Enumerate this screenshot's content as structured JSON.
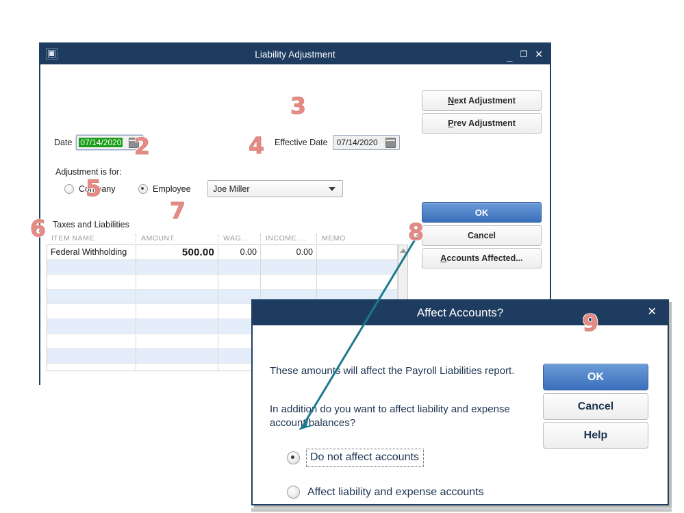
{
  "main_window": {
    "title": "Liability Adjustment",
    "system_menu_icon": "window-system-menu-icon",
    "minimize_glyph": "_",
    "maximize_glyph": "❐",
    "close_glyph": "✕",
    "buttons": {
      "next_adjustment": "Next Adjustment",
      "next_adjustment_accel": "N",
      "prev_adjustment": "Prev Adjustment",
      "prev_adjustment_accel": "P",
      "ok": "OK",
      "cancel": "Cancel",
      "accounts_affected": "Accounts Affected...",
      "accounts_affected_accel": "A"
    },
    "date_field": {
      "label": "Date",
      "value": "07/14/2020",
      "calendar_icon": "calendar-icon"
    },
    "effective_date_field": {
      "label": "Effective Date",
      "value": "07/14/2020",
      "calendar_icon": "calendar-icon"
    },
    "adjustment_for": {
      "label": "Adjustment is for:",
      "options": [
        {
          "label": "Company",
          "selected": false
        },
        {
          "label": "Employee",
          "selected": true
        }
      ]
    },
    "employee_select": {
      "value": "Joe Miller",
      "caret_icon": "chevron-down-icon"
    },
    "taxes_section": {
      "label": "Taxes and Liabilities",
      "columns": [
        "ITEM NAME",
        "AMOUNT",
        "WAG...",
        "INCOME ...",
        "MEMO"
      ],
      "rows": [
        {
          "item_name": "Federal Withholding",
          "amount": "500.00",
          "wage_base": "0.00",
          "income_subject_to_tax": "0.00",
          "memo": ""
        }
      ],
      "empty_row_count": 8,
      "scrollbar_up_icon": "scroll-up-arrow-icon"
    }
  },
  "affect_dialog": {
    "title": "Affect Accounts?",
    "close_glyph": "✕",
    "paragraph_1": "These amounts will affect the Payroll Liabilities report.",
    "paragraph_2": "In addition do you want to affect liability and expense account balances?",
    "options": [
      {
        "label": "Do not affect accounts",
        "selected": true
      },
      {
        "label": "Affect liability and expense accounts",
        "selected": false
      }
    ],
    "buttons": {
      "ok": "OK",
      "cancel": "Cancel",
      "help": "Help"
    }
  },
  "callouts": [
    {
      "id": "2",
      "label": "2"
    },
    {
      "id": "3",
      "label": "3"
    },
    {
      "id": "4",
      "label": "4"
    },
    {
      "id": "5",
      "label": "5"
    },
    {
      "id": "6",
      "label": "6"
    },
    {
      "id": "7",
      "label": "7"
    },
    {
      "id": "8",
      "label": "8"
    },
    {
      "id": "9",
      "label": "9"
    }
  ],
  "colors": {
    "titlebar": "#1e3c5f",
    "primary_button": "#3b6fba",
    "callout": "#e38b84",
    "arrow": "#1b7a8c",
    "date_selection": "#1a9e1a",
    "row_alt": "#e4eefb"
  }
}
